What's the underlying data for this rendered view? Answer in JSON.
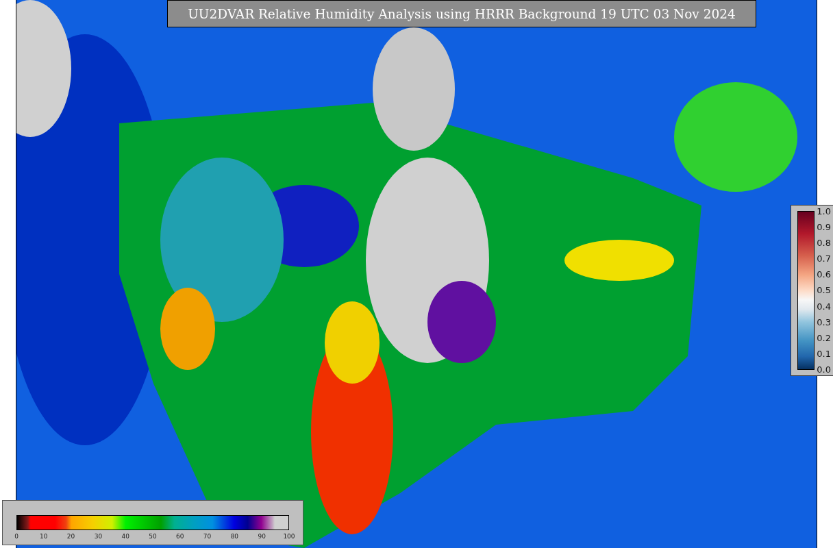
{
  "title": "UU2DVAR Relative Humidity Analysis using HRRR Background 19 UTC 03 Nov 2024",
  "humidity_colorbar": {
    "ticks": [
      "0",
      "10",
      "20",
      "30",
      "40",
      "50",
      "60",
      "70",
      "80",
      "90",
      "100"
    ]
  },
  "station_colorbar": {
    "ticks": [
      "1.0",
      "0.9",
      "0.8",
      "0.7",
      "0.6",
      "0.5",
      "0.4",
      "0.3",
      "0.2",
      "0.1",
      "0.0"
    ]
  }
}
